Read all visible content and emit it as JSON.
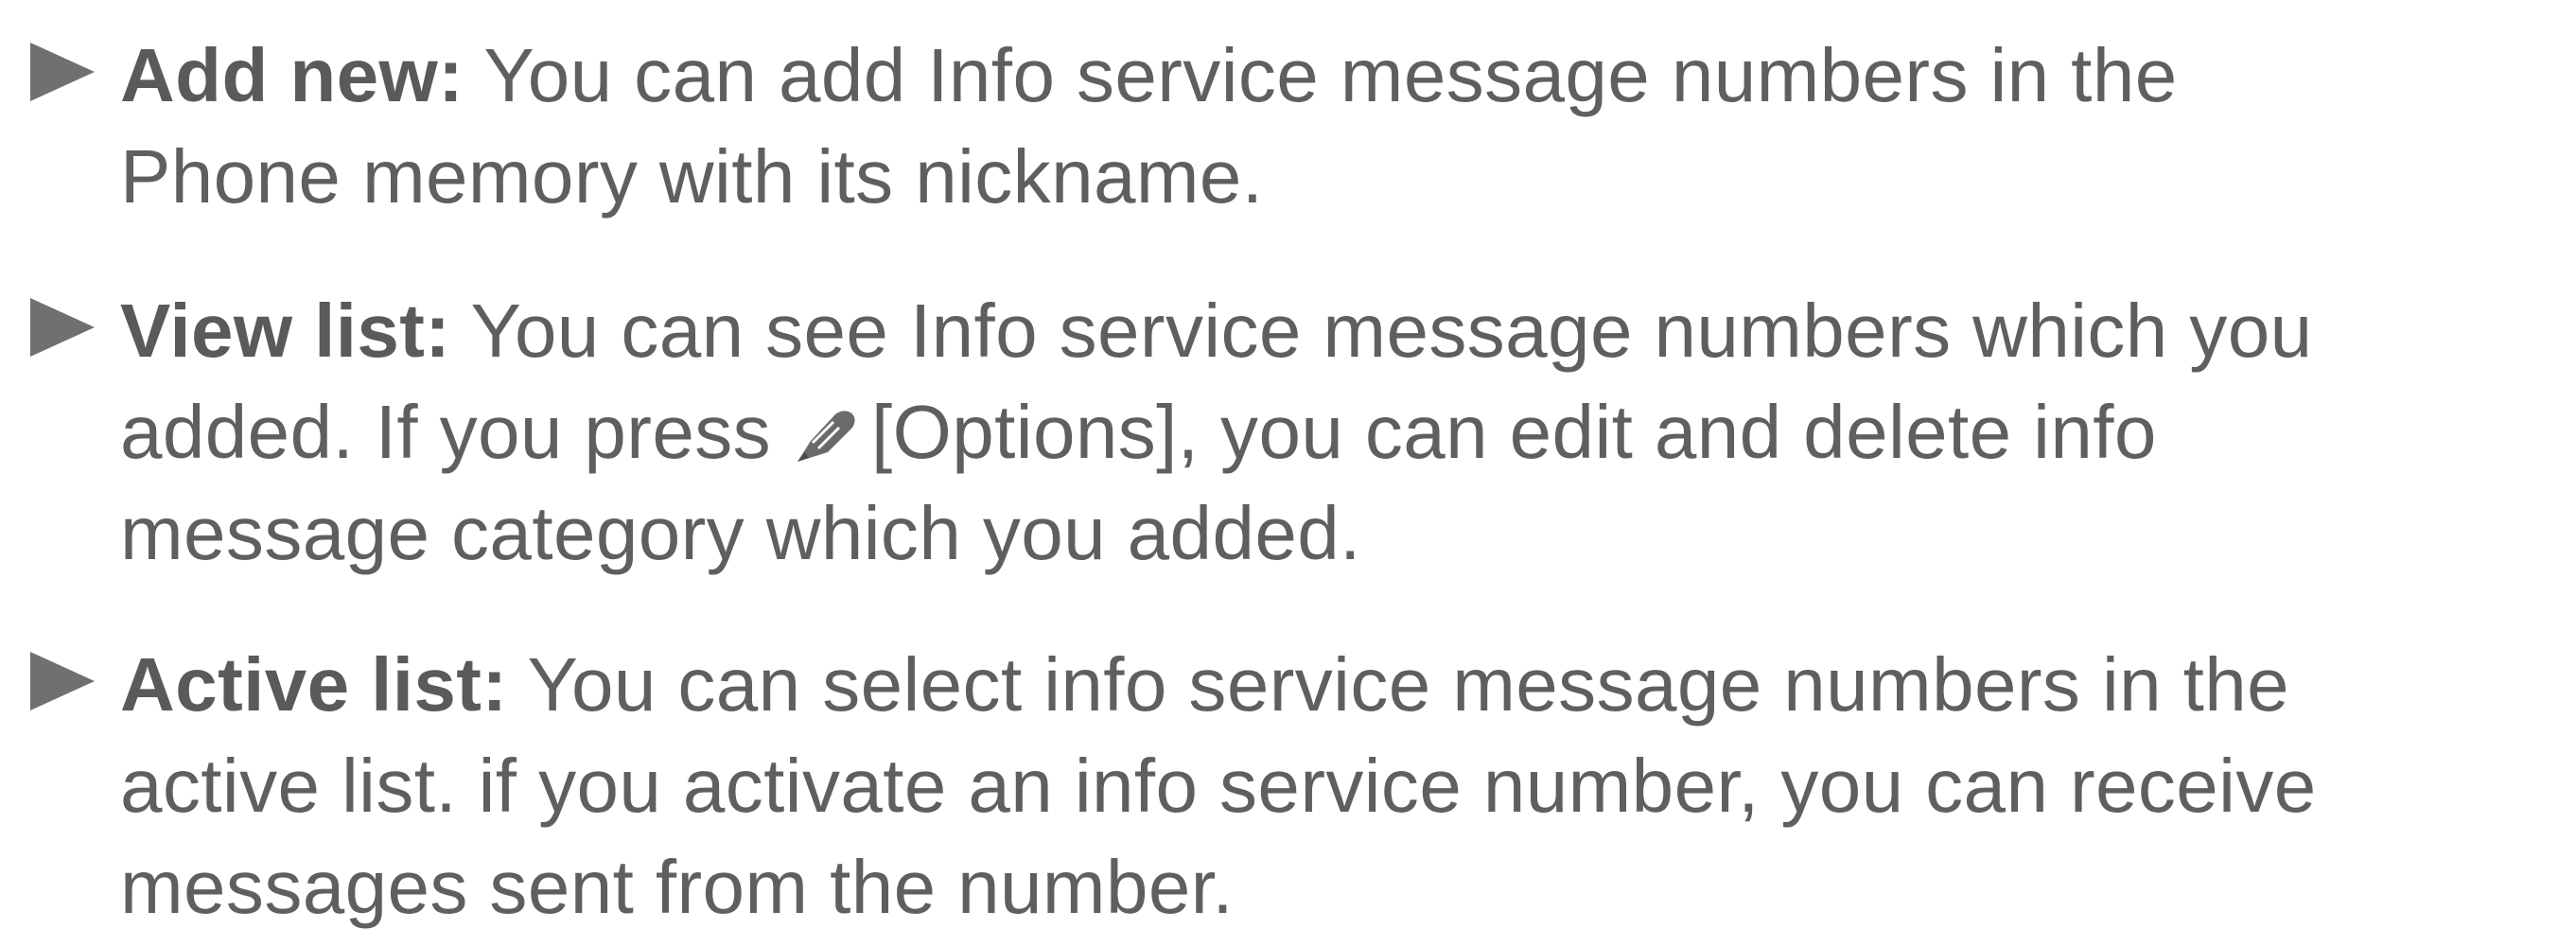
{
  "items": [
    {
      "term": "Add new:",
      "lines": [
        " You can add Info service message numbers in the",
        "Phone memory with its nickname."
      ]
    },
    {
      "term": "View list:",
      "lines": [
        " You can see Info service message numbers which you",
        "added. If you press",
        "[Options], you can edit and delete info",
        "message category which you added."
      ],
      "icon": "pencil-softkey-icon"
    },
    {
      "term": "Active list:",
      "lines": [
        " You can select info service message numbers in the",
        "active list. if you activate an info service number, you can receive",
        "messages sent from the number."
      ]
    }
  ],
  "colors": {
    "text": "#5f5f5f",
    "bullet": "#707070"
  }
}
